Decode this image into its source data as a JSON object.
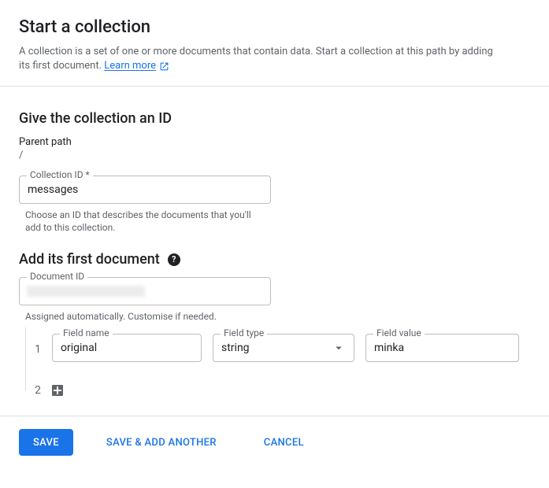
{
  "header": {
    "title": "Start a collection",
    "description_a": "A collection is a set of one or more documents that contain data. Start a collection at this path by adding its first document. ",
    "learn_more": "Learn more"
  },
  "sections": {
    "give_id": "Give the collection an ID",
    "add_doc": "Add its first document"
  },
  "parent_path": {
    "label": "Parent path",
    "value": "/"
  },
  "collection_id": {
    "label": "Collection ID *",
    "value": "messages",
    "helper": "Choose an ID that describes the documents that you'll add to this collection."
  },
  "document_id": {
    "label": "Document ID",
    "helper": "Assigned automatically. Customise if needed."
  },
  "field_row": {
    "number": "1",
    "name_label": "Field name",
    "name_value": "original",
    "type_label": "Field type",
    "type_value": "string",
    "value_label": "Field value",
    "value_value": "minka"
  },
  "add_row_number": "2",
  "footer": {
    "save": "Save",
    "save_add": "Save & add another",
    "cancel": "Cancel"
  }
}
